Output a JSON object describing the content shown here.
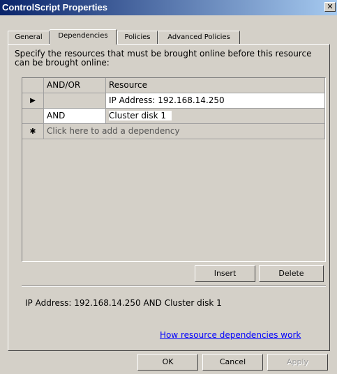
{
  "window": {
    "title": "ControlScript Properties",
    "close_glyph": "✕"
  },
  "tabs": [
    {
      "label": "General",
      "active": false
    },
    {
      "label": "Dependencies",
      "active": true
    },
    {
      "label": "Policies",
      "active": false
    },
    {
      "label": "Advanced Policies",
      "active": false
    }
  ],
  "instructions": "Specify the resources that must be brought online before this resource can be brought online:",
  "grid": {
    "columns": [
      "AND/OR",
      "Resource"
    ],
    "rows": [
      {
        "indicator": "▶",
        "and_or": "",
        "resource": "IP Address: 192.168.14.250"
      },
      {
        "indicator": "",
        "and_or": "AND",
        "resource": "Cluster disk 1"
      }
    ],
    "new_row": {
      "indicator": "✱",
      "placeholder": "Click here to add a dependency"
    }
  },
  "grid_buttons": {
    "insert": "Insert",
    "delete": "Delete"
  },
  "summary": "IP Address: 192.168.14.250 AND Cluster disk 1",
  "help_link": "How resource dependencies work",
  "dialog_buttons": {
    "ok": "OK",
    "cancel": "Cancel",
    "apply": "Apply"
  },
  "colors": {
    "title_start": "#0a246a",
    "title_end": "#a6caf0",
    "face": "#d4d0c8",
    "link": "#0000ff"
  }
}
